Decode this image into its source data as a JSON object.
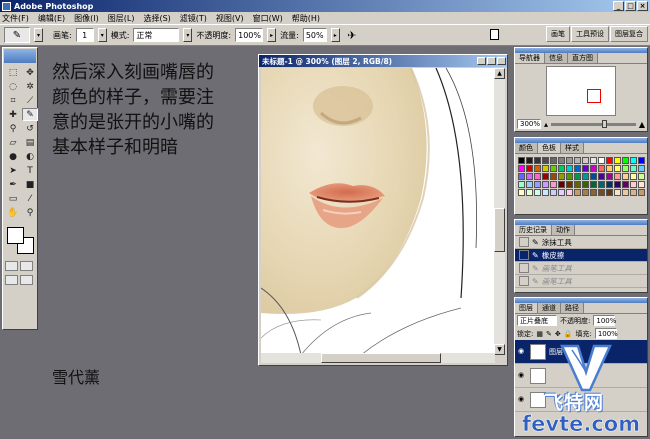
{
  "window": {
    "title": "Adobe Photoshop"
  },
  "menu": [
    "文件(F)",
    "编辑(E)",
    "图像(I)",
    "图层(L)",
    "选择(S)",
    "滤镜(T)",
    "视图(V)",
    "窗口(W)",
    "帮助(H)"
  ],
  "options": {
    "brush_label": "画笔:",
    "brush_size": "1",
    "mode_label": "模式:",
    "mode_value": "正常",
    "opacity_label": "不透明度:",
    "opacity_value": "100%",
    "flow_label": "流量:",
    "flow_value": "50%"
  },
  "palette_well": [
    "画笔",
    "工具预设",
    "图层复合"
  ],
  "tutorial": {
    "line1": "然后深入刻画嘴唇的",
    "line2": "颜色的样子，需要注",
    "line3": "意的是张开的小嘴的",
    "line4": "基本样子和明暗"
  },
  "signature": "雪代薰",
  "document": {
    "title": "未标题-1 @ 300% (图层 2, RGB/8)"
  },
  "navigator": {
    "tabs": [
      "导航器",
      "信息",
      "直方图"
    ],
    "zoom": "300%"
  },
  "swatches_panel": {
    "tabs": [
      "颜色",
      "色板",
      "样式"
    ],
    "colors": [
      "#000000",
      "#1a1a1a",
      "#333333",
      "#4d4d4d",
      "#666666",
      "#808080",
      "#999999",
      "#b3b3b3",
      "#cccccc",
      "#e6e6e6",
      "#ffffff",
      "#ff0000",
      "#ffff00",
      "#00ff00",
      "#00ffff",
      "#0000ff",
      "#ff00ff",
      "#cc0000",
      "#cc6600",
      "#cccc00",
      "#66cc00",
      "#00cc66",
      "#00cccc",
      "#0066cc",
      "#6600cc",
      "#cc00cc",
      "#ff6666",
      "#ffcc66",
      "#ffff66",
      "#99ff66",
      "#66ffcc",
      "#66ccff",
      "#6666ff",
      "#cc66ff",
      "#ff66cc",
      "#990000",
      "#994c00",
      "#999900",
      "#4c9900",
      "#00994c",
      "#009999",
      "#004c99",
      "#4c0099",
      "#990099",
      "#ff9999",
      "#ffcc99",
      "#ffff99",
      "#ccff99",
      "#99ffcc",
      "#99ccff",
      "#9999ff",
      "#cc99ff",
      "#ff99cc",
      "#660000",
      "#663300",
      "#666600",
      "#336600",
      "#006633",
      "#006666",
      "#003366",
      "#330066",
      "#660066",
      "#ffcccc",
      "#ffe6cc",
      "#ffffcc",
      "#e6ffcc",
      "#ccffe6",
      "#cce6ff",
      "#ccccff",
      "#e6ccff",
      "#ffcce6",
      "#c69c6d",
      "#a67c52",
      "#8c6239",
      "#754c24",
      "#603913",
      "#f7e4c8",
      "#e8c9a0",
      "#d9b38c",
      "#c49a6c"
    ]
  },
  "history": {
    "tabs": [
      "历史记录",
      "动作"
    ],
    "items": [
      {
        "label": "涂抹工具",
        "state": "normal"
      },
      {
        "label": "橡皮擦",
        "state": "selected"
      },
      {
        "label": "画笔工具",
        "state": "dim"
      },
      {
        "label": "画笔工具",
        "state": "dim"
      }
    ]
  },
  "layers": {
    "tabs": [
      "图层",
      "通道",
      "路径"
    ],
    "blend_mode": "正片叠底",
    "opacity_label": "不透明度:",
    "opacity_value": "100%",
    "lock_label": "锁定:",
    "fill_label": "填充:",
    "fill_value": "100%",
    "items": [
      {
        "label": "图层 2",
        "selected": true
      },
      {
        "label": "",
        "selected": false
      },
      {
        "label": "",
        "selected": false
      }
    ]
  },
  "watermark": {
    "cn": "飞特网",
    "en": "fevte.com"
  }
}
